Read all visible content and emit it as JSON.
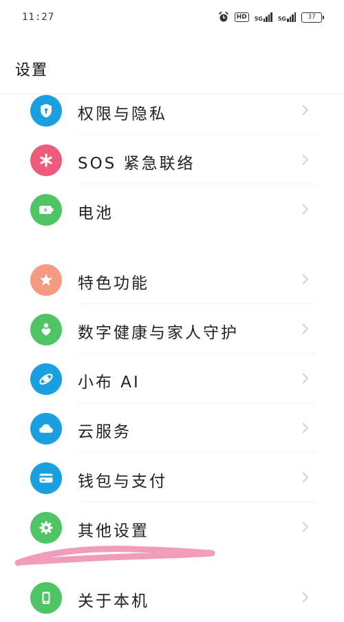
{
  "status_bar": {
    "time": "11:27",
    "hd_label": "HD",
    "signal1_label": "5G",
    "signal2_label": "5G",
    "battery_level": "37"
  },
  "header": {
    "title": "设置"
  },
  "settings": [
    {
      "label": "权限与隐私",
      "icon": "shield-icon",
      "color": "#1a9fe0"
    },
    {
      "label": "SOS 紧急联络",
      "icon": "asterisk-icon",
      "color": "#ef5b7a"
    },
    {
      "label": "电池",
      "icon": "battery-icon",
      "color": "#4fc464"
    },
    {
      "label": "特色功能",
      "icon": "star-icon",
      "color": "#f49a80"
    },
    {
      "label": "数字健康与家人守护",
      "icon": "family-heart-icon",
      "color": "#4fc464"
    },
    {
      "label": "小布 AI",
      "icon": "ai-assistant-icon",
      "color": "#1a9fe0"
    },
    {
      "label": "云服务",
      "icon": "cloud-icon",
      "color": "#1a9fe0"
    },
    {
      "label": "钱包与支付",
      "icon": "wallet-icon",
      "color": "#1a9fe0"
    },
    {
      "label": "其他设置",
      "icon": "gear-icon",
      "color": "#4fc464"
    },
    {
      "label": "关于本机",
      "icon": "phone-icon",
      "color": "#4fc464"
    }
  ],
  "annotation": {
    "stroke_color": "#f08bb0"
  }
}
